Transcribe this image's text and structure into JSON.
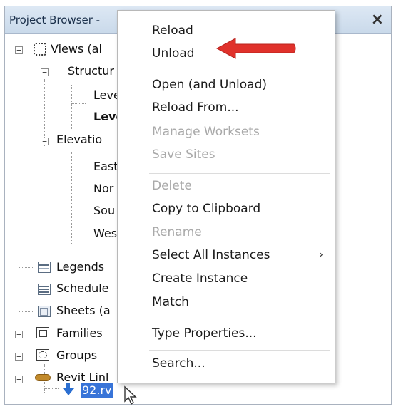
{
  "panel": {
    "title": "Project Browser -",
    "close_glyph": "×"
  },
  "tree": {
    "views": "Views (al",
    "structural": "Structur",
    "level1": "Leve",
    "level2": "Leve",
    "elevations": "Elevatio",
    "east": "East",
    "north": "Nor",
    "south": "Sou",
    "west": "Wes",
    "legends": "Legends",
    "schedules": "Schedule",
    "sheets": "Sheets (a",
    "families": "Families",
    "groups": "Groups",
    "revit_links": "Revit Linl",
    "link_file": "92.rv"
  },
  "menu": {
    "reload": "Reload",
    "unload": "Unload",
    "open_unload": "Open (and Unload)",
    "reload_from": "Reload From...",
    "manage_worksets": "Manage Worksets",
    "save_sites": "Save Sites",
    "delete": "Delete",
    "copy_clipboard": "Copy to Clipboard",
    "rename": "Rename",
    "select_all": "Select All Instances",
    "create_instance": "Create Instance",
    "match": "Match",
    "type_properties": "Type Properties...",
    "search": "Search..."
  },
  "colors": {
    "annotation_arrow": "#e0312b",
    "selection": "#3874d8"
  }
}
